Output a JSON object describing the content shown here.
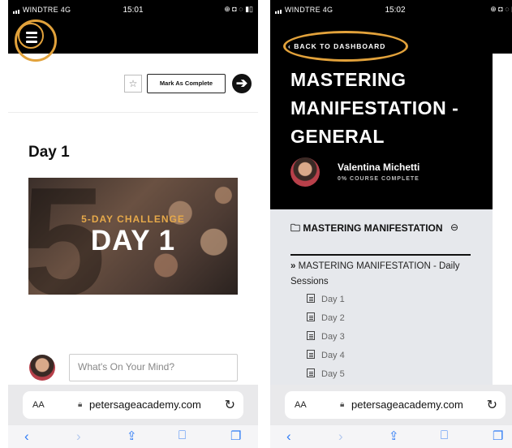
{
  "left": {
    "status": {
      "carrier": "WINDTRE 4G",
      "time": "15:01",
      "icons": "⊕ ◘ ◌ ▮▯"
    },
    "complete_label": "Mark As Complete",
    "star": "☆",
    "next": "➔",
    "day_heading": "Day 1",
    "video": {
      "bg_number": "5",
      "challenge": "5-DAY CHALLENGE",
      "day": "DAY 1"
    },
    "comment_placeholder": "What's On Your Mind?",
    "browser": {
      "aa": "AA",
      "url": "petersageacademy.com",
      "reload": "↻"
    }
  },
  "right": {
    "status": {
      "carrier": "WINDTRE 4G",
      "time": "15:02",
      "icons": "⊕ ◘ ◌ ▮"
    },
    "back_label": "BACK TO DASHBOARD",
    "course_title": "MASTERING MANIFESTATION - GENERAL",
    "user_name": "Valentina Michetti",
    "user_progress": "0% COURSE COMPLETE",
    "module": "MASTERING MANIFESTATION",
    "lesson": "MASTERING MANIFESTATION - Daily Sessions",
    "lesson_marker": "»",
    "days": [
      "Day 1",
      "Day 2",
      "Day 3",
      "Day 4",
      "Day 5"
    ],
    "browser": {
      "aa": "AA",
      "url": "petersageacademy.com",
      "reload": "↻"
    }
  },
  "toolbar_icons": [
    "back-icon",
    "forward-icon",
    "share-icon",
    "bookmarks-icon",
    "tabs-icon"
  ],
  "colors": {
    "accent_ring": "#e2a23b",
    "link_blue": "#2f7cf6",
    "sidebar_bg": "#e6e8ec"
  }
}
